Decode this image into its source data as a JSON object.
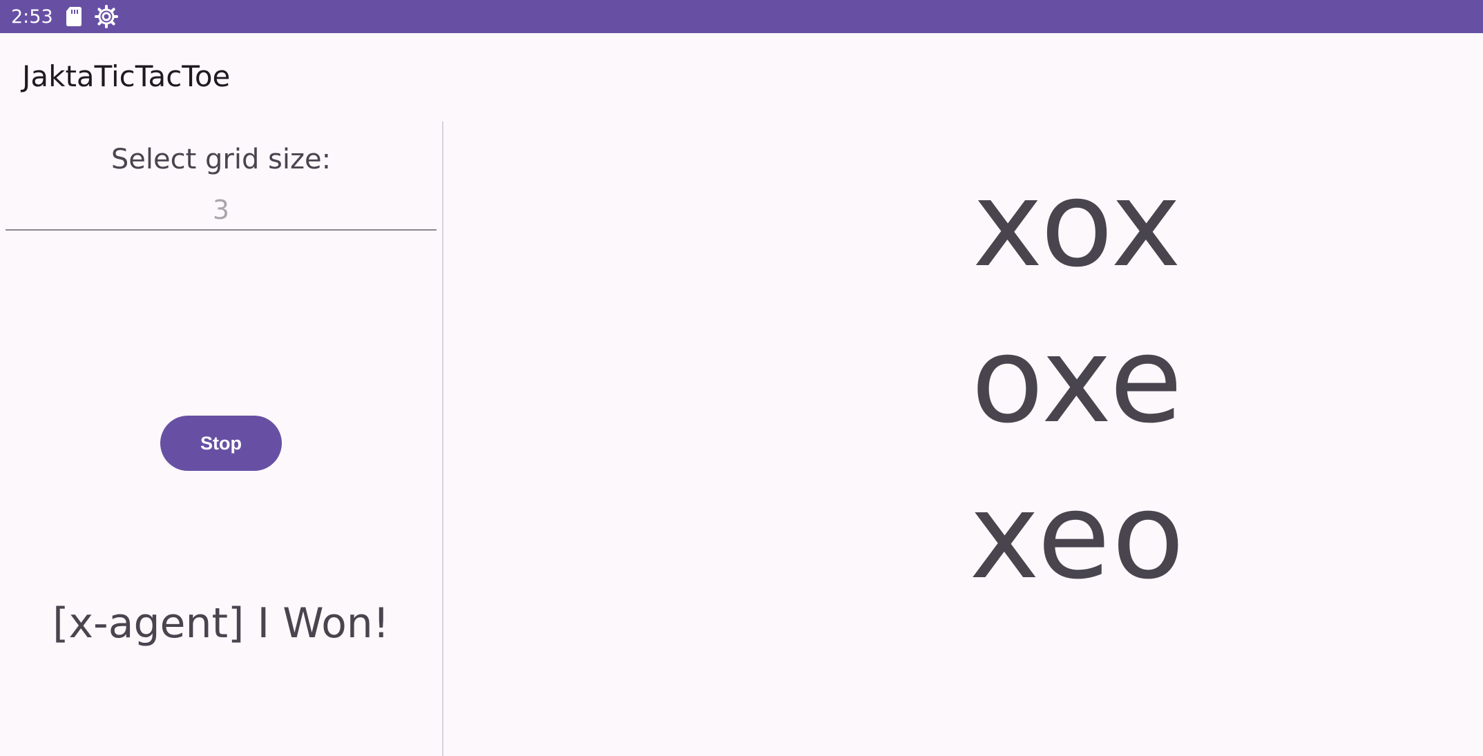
{
  "status_bar": {
    "time": "2:53",
    "icons": [
      "sd-card-icon",
      "settings-gear-icon"
    ],
    "background_color": "#6750a4"
  },
  "app": {
    "title": "JaktaTicTacToe"
  },
  "left_panel": {
    "grid_label": "Select grid size:",
    "grid_input_placeholder": "3",
    "grid_input_value": "",
    "stop_label": "Stop",
    "message": "[x-agent] I Won!"
  },
  "board": {
    "rows": [
      "xox",
      "oxe",
      "xeo"
    ]
  },
  "colors": {
    "accent": "#6750a4",
    "background": "#fdf8fc",
    "text": "#49454f"
  }
}
